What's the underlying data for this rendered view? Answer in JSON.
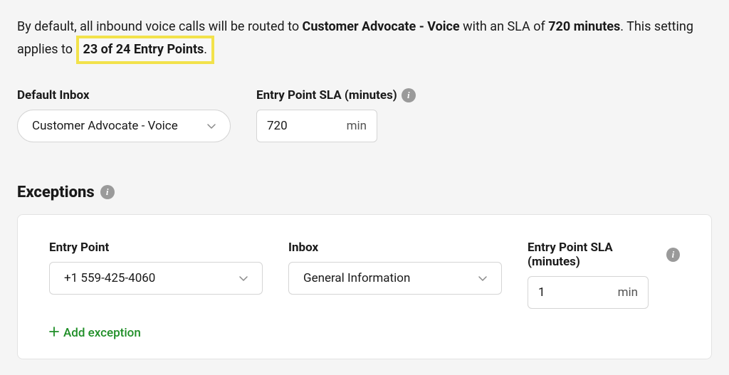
{
  "intro": {
    "part1": "By default, all inbound voice calls will be routed to ",
    "routed_to": "Customer Advocate - Voice",
    "part2": " with an SLA of ",
    "sla": "720 minutes",
    "part3": ". This setting applies to ",
    "entry_points": "23 of 24 Entry Points",
    "part4": "."
  },
  "default": {
    "inbox_label": "Default Inbox",
    "inbox_value": "Customer Advocate - Voice",
    "sla_label": "Entry Point SLA (minutes)",
    "sla_value": "720",
    "sla_unit": "min"
  },
  "exceptions": {
    "title": "Exceptions",
    "col_entry": "Entry Point",
    "col_inbox": "Inbox",
    "col_sla": "Entry Point SLA (minutes)",
    "row": {
      "entry_point": "+1 559-425-4060",
      "inbox": "General Information",
      "sla_value": "1",
      "sla_unit": "min"
    },
    "add_label": "Add exception"
  }
}
